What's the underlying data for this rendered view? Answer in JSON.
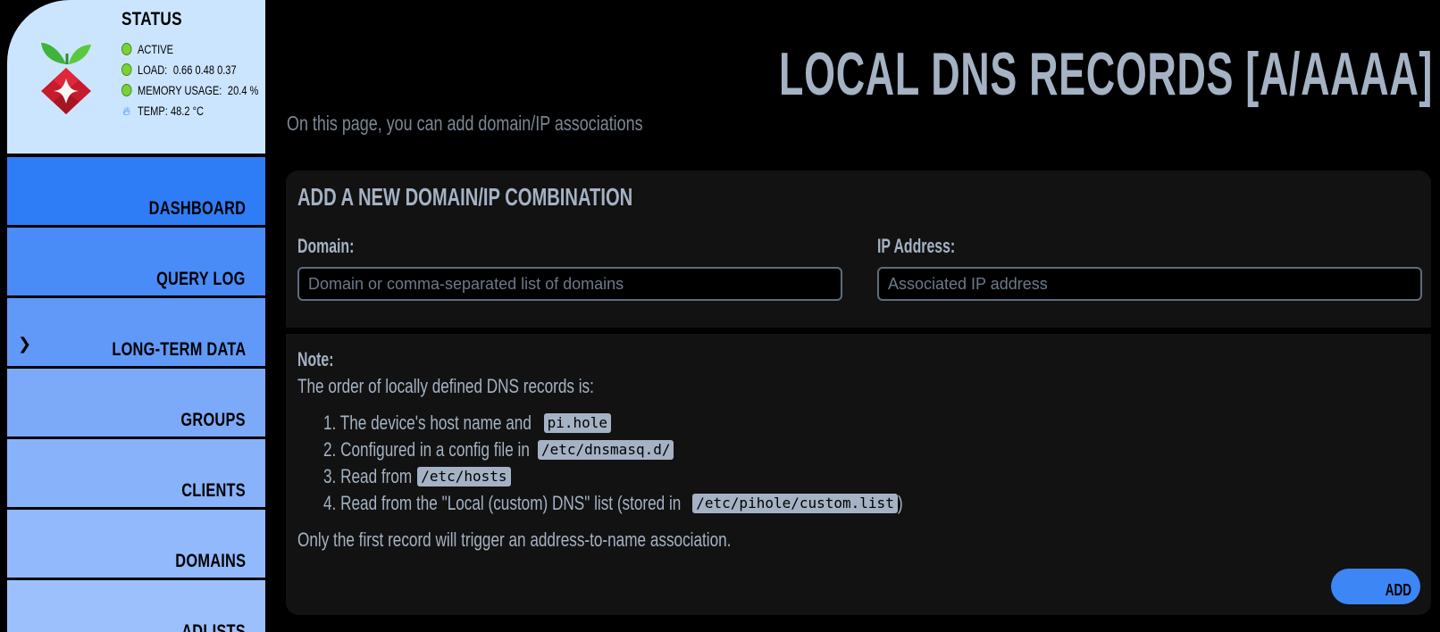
{
  "status": {
    "title": "STATUS",
    "active": "ACTIVE",
    "load_label": "LOAD:",
    "load_value": "0.66  0.48  0.37",
    "memory_label": "MEMORY USAGE:",
    "memory_value": "20.4 %",
    "temp": "TEMP: 48.2 °C"
  },
  "sidebar": {
    "items": [
      {
        "label": "DASHBOARD",
        "color": "#2f7df6"
      },
      {
        "label": "QUERY LOG",
        "color": "#4a8cf7"
      },
      {
        "label": "LONG-TERM DATA",
        "color": "#6199f8"
      },
      {
        "label": "GROUPS",
        "color": "#7caaf9"
      },
      {
        "label": "CLIENTS",
        "color": "#88b2fa"
      },
      {
        "label": "DOMAINS",
        "color": "#92b9fb"
      },
      {
        "label": "ADLISTS",
        "color": "#9cc0fb"
      }
    ]
  },
  "page": {
    "title": "LOCAL DNS RECORDS [A/AAAA]",
    "subtitle": "On this page, you can add domain/IP associations"
  },
  "form": {
    "title": "ADD A NEW DOMAIN/IP COMBINATION",
    "domain_label": "Domain:",
    "domain_placeholder": "Domain or comma-separated list of domains",
    "ip_label": "IP Address:",
    "ip_placeholder": "Associated IP address"
  },
  "note": {
    "label": "Note:",
    "intro": "The order of locally defined DNS records is:",
    "items": [
      {
        "num": "1.",
        "text": "The device's host name and",
        "code": "pi.hole",
        "after": ""
      },
      {
        "num": "2.",
        "text": "Configured in a config file in",
        "code": "/etc/dnsmasq.d/",
        "after": ""
      },
      {
        "num": "3.",
        "text": "Read from",
        "code": "/etc/hosts",
        "after": ""
      },
      {
        "num": "4.",
        "text": "Read from the \"Local (custom) DNS\" list (stored in",
        "code": "/etc/pihole/custom.list",
        "after": ")"
      }
    ],
    "footer": "Only the first record will trigger an address-to-name association."
  },
  "actions": {
    "add_label": "ADD"
  },
  "colors": {
    "accent": "#3d86f5",
    "text": "#a4b2c4",
    "status_green": "#7cd13a"
  }
}
